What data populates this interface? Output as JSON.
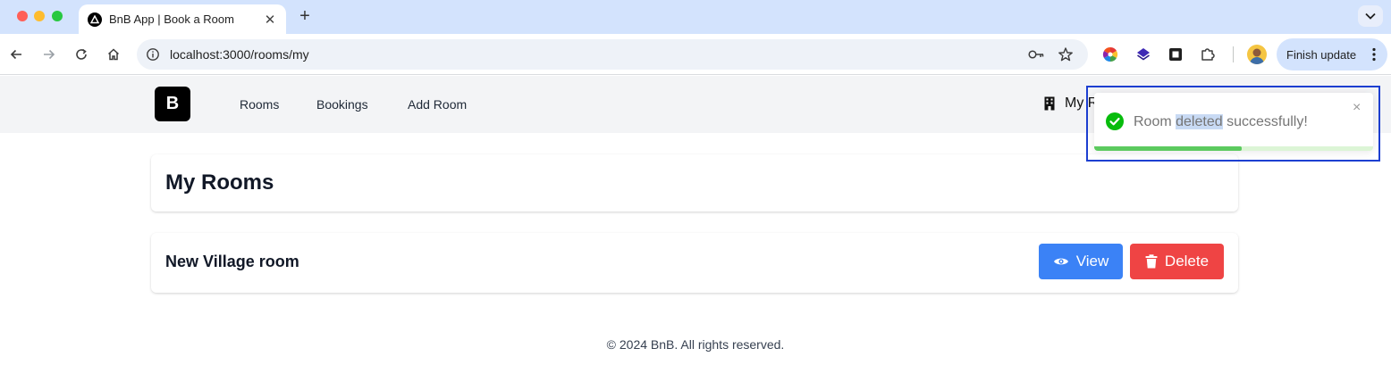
{
  "browser": {
    "tab": {
      "title": "BnB App | Book a Room",
      "close_icon": "✕"
    },
    "new_tab_label": "+",
    "url": "localhost:3000/rooms/my",
    "finish_update_label": "Finish update"
  },
  "app": {
    "logo": "B",
    "nav": [
      "Rooms",
      "Bookings",
      "Add Room"
    ],
    "my_rooms_link": "My R"
  },
  "page": {
    "title": "My Rooms",
    "rooms": [
      {
        "name": "New Village room",
        "view_label": "View",
        "delete_label": "Delete"
      }
    ],
    "footer": "© 2024 BnB. All rights reserved."
  },
  "toast": {
    "message_before": "Room ",
    "message_highlight": "deleted",
    "message_after": " successfully!",
    "close_icon": "×",
    "progress": 0.53,
    "type": "success"
  },
  "colors": {
    "primary": "#3b82f6",
    "danger": "#ef4444",
    "success": "#5cca5f",
    "toast_outline": "#1d3fd1"
  }
}
